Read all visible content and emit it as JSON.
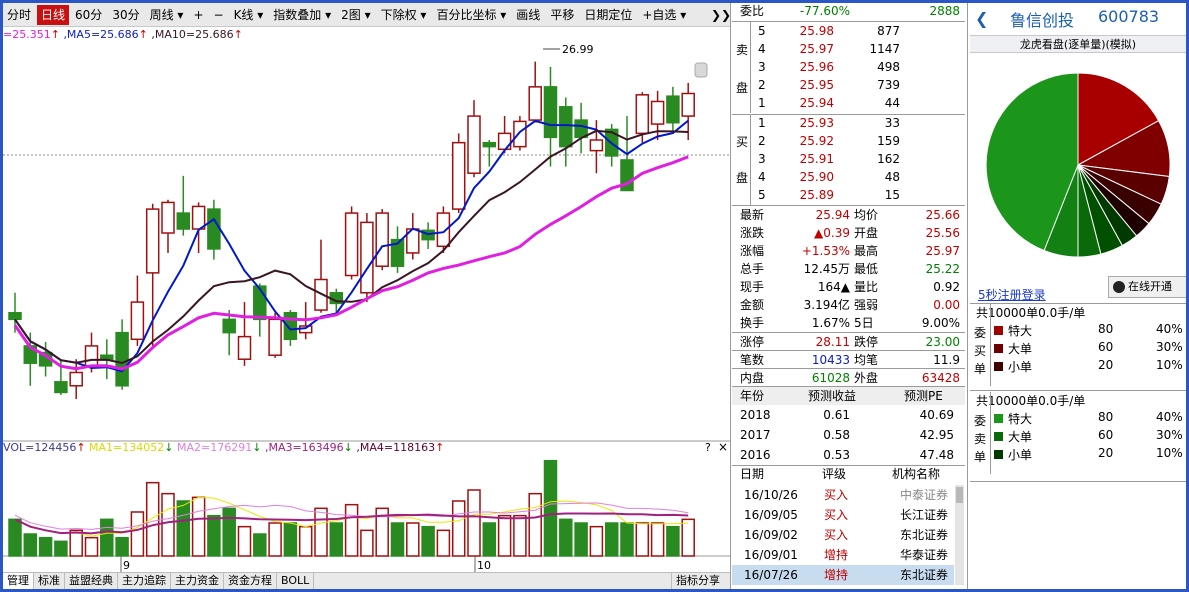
{
  "toolbar": {
    "items": [
      "分时",
      "日线",
      "60分",
      "30分",
      "周线 ▾",
      "+",
      "−",
      "K线 ▾",
      "指数叠加 ▾",
      "2图 ▾",
      "下除权 ▾",
      "百分比坐标 ▾",
      "画线",
      "平移",
      "日期定位",
      "+自选 ▾"
    ],
    "selected": 1,
    "more_icon": "double-chevron-right-icon"
  },
  "legend": {
    "ma_prefix": "=25.351",
    "ma5": ",MA5=25.686",
    "ma10": ",MA10=25.686",
    "arrow_up": "↑"
  },
  "price_chart": {
    "high_label": "26.99",
    "month_labels": [
      "9",
      "10"
    ]
  },
  "volume_legend": {
    "vol": "VOL=124456",
    "vol_arrow": "↑",
    "ma1": "MA1=134052",
    "ma1_arrow": "↓",
    "ma2": "MA2=176291",
    "ma2_arrow": "↓",
    "ma3": ",MA3=163496",
    "ma3_arrow": "↓",
    "ma4": ",MA4=118163",
    "ma4_arrow": "↑",
    "help": "?",
    "close": "×"
  },
  "colors": {
    "up": "#a01010",
    "down": "#2a8a22",
    "ma5": "#0018c8",
    "ma10": "#3a1525",
    "ma20": "#e020e0",
    "bg": "#ffffff"
  },
  "bottom_tabs": [
    "管理",
    "标准",
    "益盟经典",
    "主力追踪",
    "主力资金",
    "资金方程",
    "BOLL"
  ],
  "bottom_right": "指标分享",
  "quote": {
    "weibi_label": "委比",
    "weibi_pct": "-77.60%",
    "weibi_val": "2888",
    "sell_label": [
      "卖",
      "盘"
    ],
    "buy_label": [
      "买",
      "盘"
    ],
    "sells": [
      {
        "lvl": "5",
        "price": "25.98",
        "vol": "877"
      },
      {
        "lvl": "4",
        "price": "25.97",
        "vol": "1147"
      },
      {
        "lvl": "3",
        "price": "25.96",
        "vol": "498"
      },
      {
        "lvl": "2",
        "price": "25.95",
        "vol": "739"
      },
      {
        "lvl": "1",
        "price": "25.94",
        "vol": "44"
      }
    ],
    "buys": [
      {
        "lvl": "1",
        "price": "25.93",
        "vol": "33"
      },
      {
        "lvl": "2",
        "price": "25.92",
        "vol": "159"
      },
      {
        "lvl": "3",
        "price": "25.91",
        "vol": "162"
      },
      {
        "lvl": "4",
        "price": "25.90",
        "vol": "48"
      },
      {
        "lvl": "5",
        "price": "25.89",
        "vol": "15"
      }
    ],
    "stats": [
      {
        "l1": "最新",
        "v1": "25.94",
        "c1": "red",
        "l2": "均价",
        "v2": "25.66",
        "c2": "red"
      },
      {
        "l1": "涨跌",
        "v1": "▲0.39",
        "c1": "red",
        "l2": "开盘",
        "v2": "25.56",
        "c2": "red"
      },
      {
        "l1": "涨幅",
        "v1": "+1.53%",
        "c1": "red",
        "l2": "最高",
        "v2": "25.97",
        "c2": "red"
      },
      {
        "l1": "总手",
        "v1": "12.45万",
        "c1": "blk",
        "l2": "最低",
        "v2": "25.22",
        "c2": "green"
      },
      {
        "l1": "现手",
        "v1": "164▲",
        "c1": "blk",
        "l2": "量比",
        "v2": "0.92",
        "c2": "blk"
      },
      {
        "l1": "金额",
        "v1": "3.194亿",
        "c1": "blk",
        "l2": "强弱",
        "v2": "0.00",
        "c2": "red"
      },
      {
        "l1": "换手",
        "v1": "1.67%",
        "c1": "blk",
        "l2": "5日",
        "v2": "9.00%",
        "c2": "blk"
      }
    ],
    "limit": {
      "l1": "涨停",
      "v1": "28.11",
      "l2": "跌停",
      "v2": "23.00"
    },
    "trades": {
      "l1": "笔数",
      "v1": "10433",
      "l2": "均笔",
      "v2": "11.9"
    },
    "inout": {
      "l1": "内盘",
      "v1": "61028",
      "l2": "外盘",
      "v2": "63428"
    },
    "forecast_head": [
      "年份",
      "预测收益",
      "预测PE"
    ],
    "forecast": [
      [
        "2018",
        "0.61",
        "40.69"
      ],
      [
        "2017",
        "0.58",
        "42.95"
      ],
      [
        "2016",
        "0.53",
        "47.48"
      ]
    ],
    "rating_head": [
      "日期",
      "评级",
      "机构名称"
    ],
    "ratings": [
      [
        "16/10/26",
        "买入",
        "中泰证券"
      ],
      [
        "16/09/05",
        "买入",
        "长江证券"
      ],
      [
        "16/09/02",
        "买入",
        "东北证券"
      ],
      [
        "16/09/01",
        "增持",
        "华泰证券"
      ],
      [
        "16/07/26",
        "增持",
        "东北证券"
      ]
    ]
  },
  "panel": {
    "back_icon": "chevron-left-icon",
    "name": "鲁信创投",
    "code": "600783",
    "subtitle": "龙虎看盘(逐单量)(模拟)",
    "register": "5秒注册登录",
    "online": "在线开通",
    "pie_colors": [
      "#a80000",
      "#800000",
      "#5a0000",
      "#3a0000",
      "#1e0000",
      "#003a00",
      "#005000",
      "#0a6a0a",
      "#128012",
      "#1b961b"
    ],
    "pie_values": [
      17,
      10,
      5,
      4,
      3,
      3,
      4,
      4,
      6,
      44
    ],
    "block1": {
      "title": "共10000单0.0手/单",
      "side": [
        "委",
        "买",
        "单"
      ],
      "rows": [
        {
          "name": "特大",
          "n": "80",
          "pct": "40%",
          "color": "#a00000"
        },
        {
          "name": "大单",
          "n": "60",
          "pct": "30%",
          "color": "#700000"
        },
        {
          "name": "小单",
          "n": "20",
          "pct": "10%",
          "color": "#400000"
        }
      ]
    },
    "block2": {
      "title": "共10000单0.0手/单",
      "side": [
        "委",
        "卖",
        "单"
      ],
      "rows": [
        {
          "name": "特大",
          "n": "80",
          "pct": "40%",
          "color": "#1b961b"
        },
        {
          "name": "大单",
          "n": "60",
          "pct": "30%",
          "color": "#0a6a0a"
        },
        {
          "name": "小单",
          "n": "20",
          "pct": "10%",
          "color": "#003a00"
        }
      ]
    }
  }
}
